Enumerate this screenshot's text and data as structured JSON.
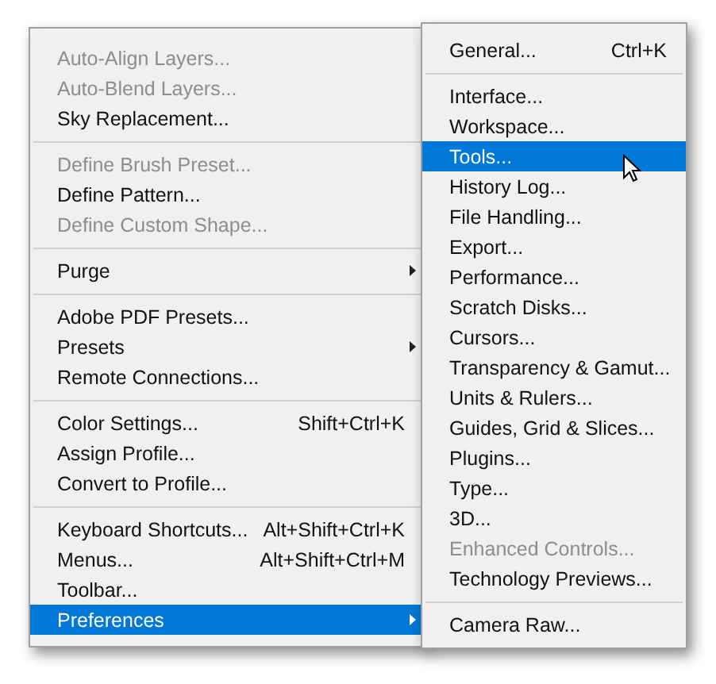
{
  "menu": {
    "groups": [
      [
        {
          "label": "Auto-Align Layers...",
          "disabled": true,
          "submenu": false,
          "selected": false
        },
        {
          "label": "Auto-Blend Layers...",
          "disabled": true,
          "submenu": false,
          "selected": false
        },
        {
          "label": "Sky Replacement...",
          "disabled": false,
          "submenu": false,
          "selected": false
        }
      ],
      [
        {
          "label": "Define Brush Preset...",
          "disabled": true,
          "submenu": false,
          "selected": false
        },
        {
          "label": "Define Pattern...",
          "disabled": false,
          "submenu": false,
          "selected": false
        },
        {
          "label": "Define Custom Shape...",
          "disabled": true,
          "submenu": false,
          "selected": false
        }
      ],
      [
        {
          "label": "Purge",
          "disabled": false,
          "submenu": true,
          "selected": false
        }
      ],
      [
        {
          "label": "Adobe PDF Presets...",
          "disabled": false,
          "submenu": false,
          "selected": false
        },
        {
          "label": "Presets",
          "disabled": false,
          "submenu": true,
          "selected": false
        },
        {
          "label": "Remote Connections...",
          "disabled": false,
          "submenu": false,
          "selected": false
        }
      ],
      [
        {
          "label": "Color Settings...",
          "shortcut": "Shift+Ctrl+K",
          "disabled": false,
          "submenu": false,
          "selected": false
        },
        {
          "label": "Assign Profile...",
          "disabled": false,
          "submenu": false,
          "selected": false
        },
        {
          "label": "Convert to Profile...",
          "disabled": false,
          "submenu": false,
          "selected": false
        }
      ],
      [
        {
          "label": "Keyboard Shortcuts...",
          "shortcut": "Alt+Shift+Ctrl+K",
          "disabled": false,
          "submenu": false,
          "selected": false
        },
        {
          "label": "Menus...",
          "shortcut": "Alt+Shift+Ctrl+M",
          "disabled": false,
          "submenu": false,
          "selected": false
        },
        {
          "label": "Toolbar...",
          "disabled": false,
          "submenu": false,
          "selected": false
        },
        {
          "label": "Preferences",
          "disabled": false,
          "submenu": true,
          "selected": true
        }
      ]
    ]
  },
  "submenu": {
    "groups": [
      [
        {
          "label": "General...",
          "shortcut": "Ctrl+K",
          "disabled": false,
          "selected": false
        }
      ],
      [
        {
          "label": "Interface...",
          "disabled": false,
          "selected": false
        },
        {
          "label": "Workspace...",
          "disabled": false,
          "selected": false
        },
        {
          "label": "Tools...",
          "disabled": false,
          "selected": true
        },
        {
          "label": "History Log...",
          "disabled": false,
          "selected": false
        },
        {
          "label": "File Handling...",
          "disabled": false,
          "selected": false
        },
        {
          "label": "Export...",
          "disabled": false,
          "selected": false
        },
        {
          "label": "Performance...",
          "disabled": false,
          "selected": false
        },
        {
          "label": "Scratch Disks...",
          "disabled": false,
          "selected": false
        },
        {
          "label": "Cursors...",
          "disabled": false,
          "selected": false
        },
        {
          "label": "Transparency & Gamut...",
          "disabled": false,
          "selected": false
        },
        {
          "label": "Units & Rulers...",
          "disabled": false,
          "selected": false
        },
        {
          "label": "Guides, Grid & Slices...",
          "disabled": false,
          "selected": false
        },
        {
          "label": "Plugins...",
          "disabled": false,
          "selected": false
        },
        {
          "label": "Type...",
          "disabled": false,
          "selected": false
        },
        {
          "label": "3D...",
          "disabled": false,
          "selected": false
        },
        {
          "label": "Enhanced Controls...",
          "disabled": true,
          "selected": false
        },
        {
          "label": "Technology Previews...",
          "disabled": false,
          "selected": false
        }
      ],
      [
        {
          "label": "Camera Raw...",
          "disabled": false,
          "selected": false
        }
      ]
    ]
  }
}
